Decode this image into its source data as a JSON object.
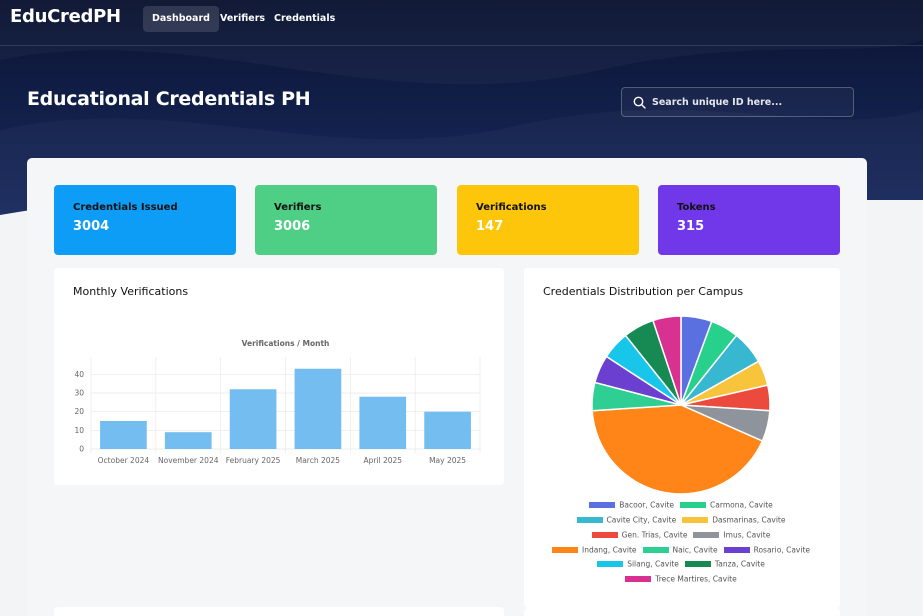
{
  "brand": "EduCredPH",
  "nav": [
    {
      "label": "Dashboard",
      "active": true
    },
    {
      "label": "Verifiers",
      "active": false
    },
    {
      "label": "Credentials",
      "active": false
    }
  ],
  "page_title": "Educational Credentials PH",
  "search": {
    "placeholder": "Search unique ID here...",
    "value": ""
  },
  "stats": [
    {
      "label": "Credentials Issued",
      "value": "3004",
      "color": "#0d9cf6"
    },
    {
      "label": "Verifiers",
      "value": "3006",
      "color": "#4fce85"
    },
    {
      "label": "Verifications",
      "value": "147",
      "color": "#fec60b"
    },
    {
      "label": "Tokens",
      "value": "315",
      "color": "#7038e8"
    }
  ],
  "monthly_card": {
    "title": "Monthly Verifications"
  },
  "distribution_card": {
    "title": "Credentials Distribution per Campus"
  },
  "chart_data": [
    {
      "type": "bar",
      "title": "Verifications / Month",
      "categories": [
        "October 2024",
        "November 2024",
        "February 2025",
        "March 2025",
        "April 2025",
        "May 2025"
      ],
      "values": [
        15,
        9,
        32,
        43,
        28,
        20
      ],
      "ylim": [
        0,
        45
      ],
      "yticks": [
        0,
        10,
        20,
        30,
        40
      ],
      "color": "#74bdf0",
      "grid": true
    },
    {
      "type": "pie",
      "legend_position": "bottom",
      "labels": [
        "Bacoor, Cavite",
        "Carmona, Cavite",
        "Cavite City, Cavite",
        "Dasmarinas, Cavite",
        "Gen. Trias, Cavite",
        "Imus, Cavite",
        "Indang, Cavite",
        "Naic, Cavite",
        "Rosario, Cavite",
        "Silang, Cavite",
        "Tanza, Cavite",
        "Trece Martires, Cavite"
      ],
      "values": [
        5.5,
        5,
        6,
        4.5,
        4.5,
        5.5,
        41.5,
        5,
        5,
        5,
        5.5,
        5
      ],
      "colors": [
        "#5a6fe0",
        "#27d18c",
        "#38b8d0",
        "#f7c43c",
        "#eb4a3c",
        "#8f939b",
        "#ff8518",
        "#2fcf93",
        "#6b3fcf",
        "#18c6ea",
        "#168a52",
        "#d93191"
      ]
    }
  ]
}
